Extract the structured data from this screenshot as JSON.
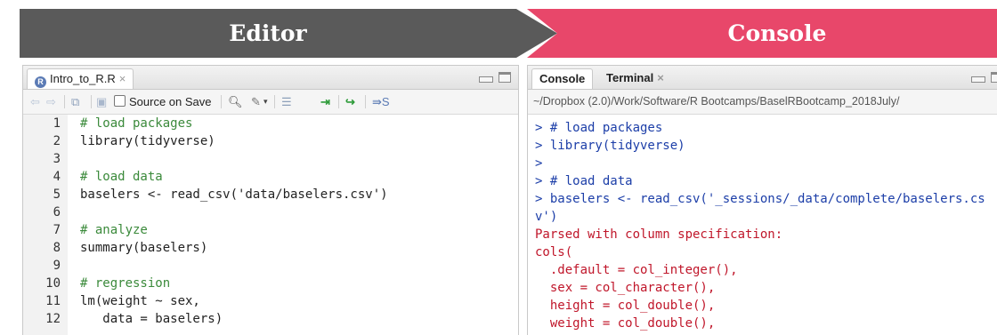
{
  "banners": {
    "editor": "Editor",
    "console": "Console"
  },
  "editor": {
    "tab_label": "Intro_to_R.R",
    "tab_close": "×",
    "source_on_save": "Source on Save",
    "run_partial": "S",
    "lines": [
      {
        "n": "1",
        "text": "# load packages",
        "type": "comment"
      },
      {
        "n": "2",
        "text": "library(tidyverse)",
        "type": "code"
      },
      {
        "n": "3",
        "text": "",
        "type": "code"
      },
      {
        "n": "4",
        "text": "# load data",
        "type": "comment"
      },
      {
        "n": "5",
        "text": "baselers <- read_csv('data/baselers.csv')",
        "type": "code"
      },
      {
        "n": "6",
        "text": "",
        "type": "code"
      },
      {
        "n": "7",
        "text": "# analyze",
        "type": "comment"
      },
      {
        "n": "8",
        "text": "summary(baselers)",
        "type": "code"
      },
      {
        "n": "9",
        "text": "",
        "type": "code"
      },
      {
        "n": "10",
        "text": "# regression",
        "type": "comment"
      },
      {
        "n": "11",
        "text": "lm(weight ~ sex,",
        "type": "code"
      },
      {
        "n": "12",
        "text": "   data = baselers)",
        "type": "code"
      }
    ]
  },
  "console": {
    "tab_console": "Console",
    "tab_terminal": "Terminal",
    "tab_close": "×",
    "path": "~/Dropbox (2.0)/Work/Software/R Bootcamps/BaselRBootcamp_2018July/",
    "lines": [
      {
        "text": "> # load packages",
        "color": "blue"
      },
      {
        "text": "> library(tidyverse)",
        "color": "blue"
      },
      {
        "text": ">",
        "color": "blue"
      },
      {
        "text": "> # load data",
        "color": "blue"
      },
      {
        "text": "> baselers <- read_csv('_sessions/_data/complete/baselers.cs",
        "color": "blue"
      },
      {
        "text": "v')",
        "color": "blue"
      },
      {
        "text": "Parsed with column specification:",
        "color": "red"
      },
      {
        "text": "cols(",
        "color": "red"
      },
      {
        "text": "  .default = col_integer(),",
        "color": "red"
      },
      {
        "text": "  sex = col_character(),",
        "color": "red"
      },
      {
        "text": "  height = col_double(),",
        "color": "red"
      },
      {
        "text": "  weight = col_double(),",
        "color": "red"
      }
    ]
  },
  "colors": {
    "editor_banner": "#5a5a5a",
    "console_banner": "#e8476a",
    "prompt_blue": "#1c3ea8",
    "message_red": "#c0162a"
  }
}
